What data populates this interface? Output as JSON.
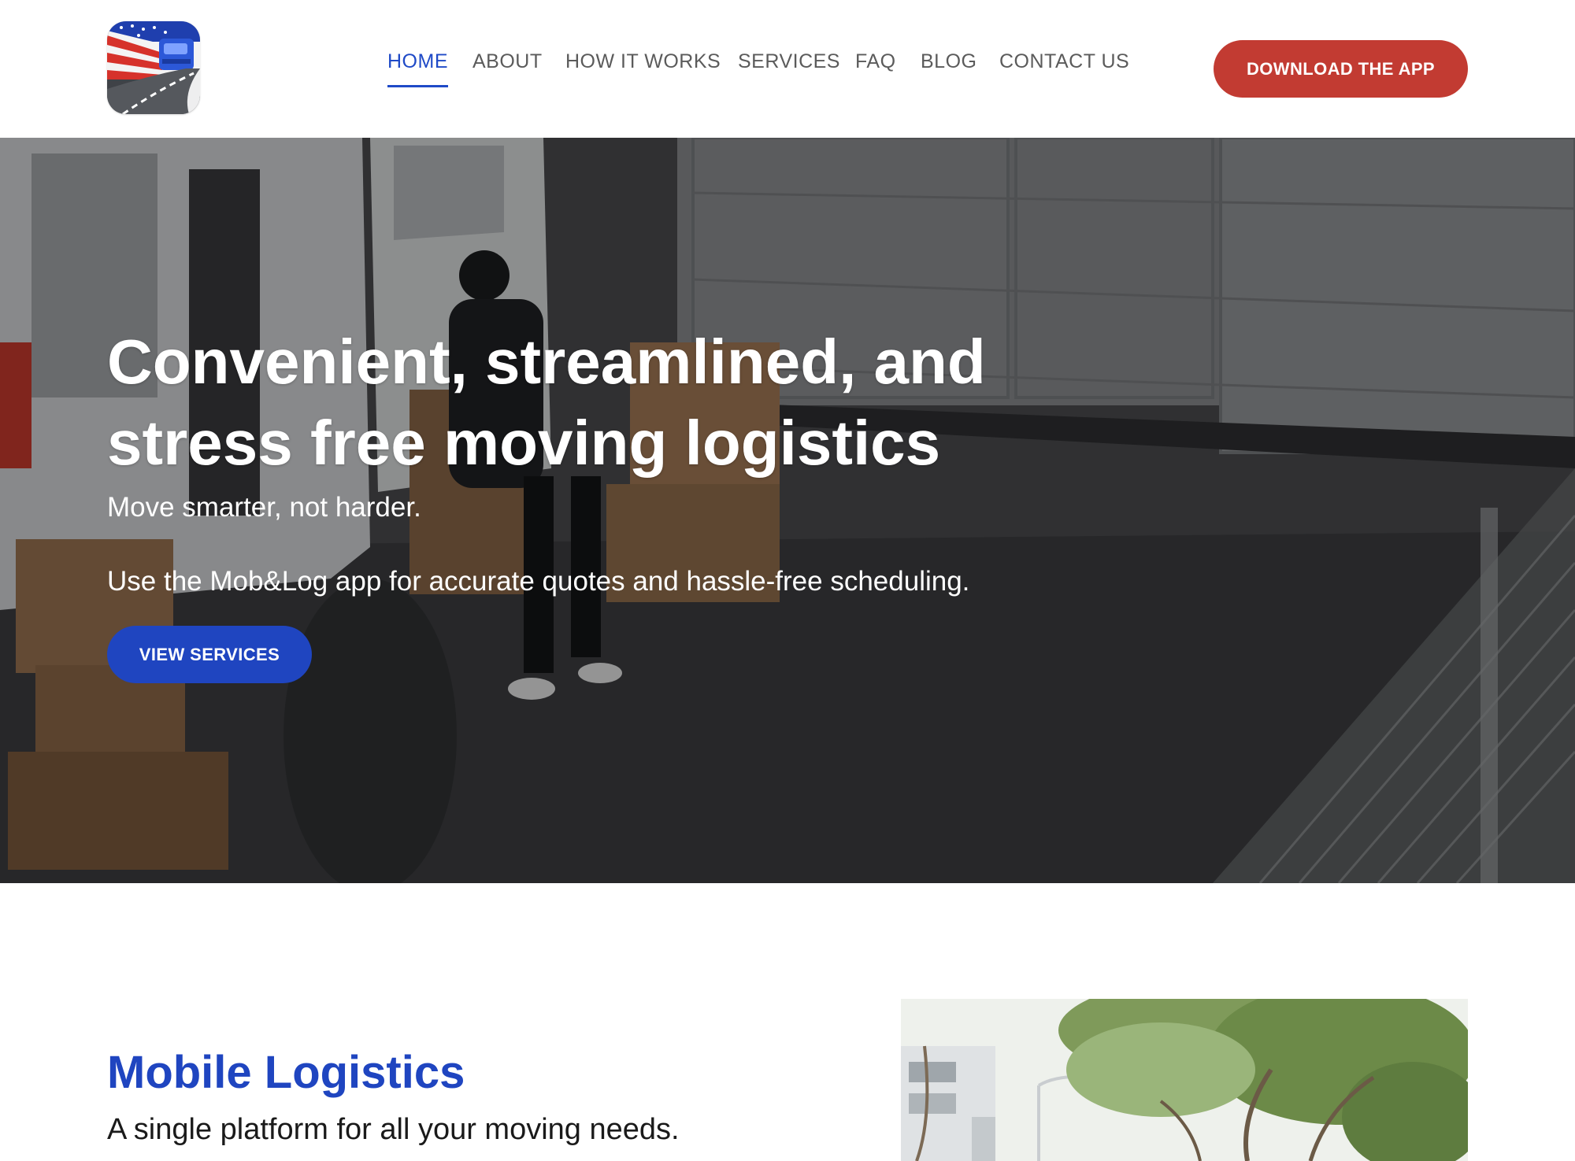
{
  "header": {
    "logo_icon": "mob-and-log-logo-icon",
    "nav": [
      {
        "label": "HOME",
        "active": true
      },
      {
        "label": "ABOUT",
        "active": false
      },
      {
        "label": "HOW IT WORKS",
        "active": false
      },
      {
        "label": "SERVICES",
        "active": false
      },
      {
        "label": "FAQ",
        "active": false
      },
      {
        "label": "BLOG",
        "active": false
      },
      {
        "label": "CONTACT US",
        "active": false
      }
    ],
    "cta_label": "DOWNLOAD THE APP"
  },
  "hero": {
    "title_line1": "Convenient, streamlined, and",
    "title_line2": "stress free moving logistics",
    "subtitle": "Move smarter, not harder.",
    "description": "Use the Mob&Log app for accurate quotes and hassle-free scheduling.",
    "button_label": "VIEW SERVICES"
  },
  "section": {
    "title": "Mobile Logistics",
    "subtitle": "A single platform for all your moving needs."
  },
  "colors": {
    "brand_blue": "#1f45c0",
    "nav_active": "#1f4ac7",
    "cta_red": "#c23b32",
    "nav_text": "#5b5b5b"
  }
}
